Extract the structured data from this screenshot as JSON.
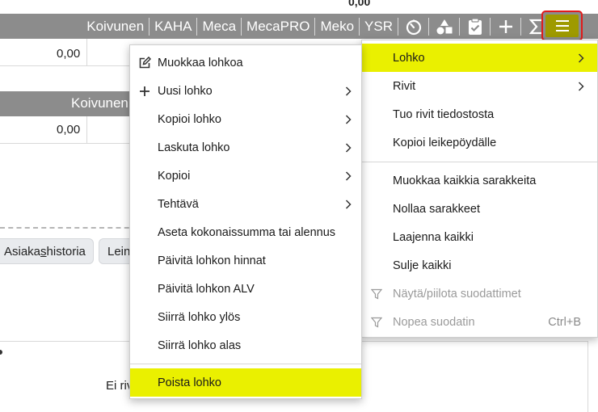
{
  "toolbar": {
    "tabs": [
      "Koivunen",
      "KAHA",
      "Meca",
      "MecaPRO",
      "Meko",
      "YSR"
    ],
    "tools": [
      "timer-icon",
      "shapes-icon",
      "clipboard-check-icon",
      "plus-icon",
      "sigma-icon"
    ],
    "menu_icon": "hamburger-menu-icon"
  },
  "background": {
    "top_total": "0,00",
    "row1_value": "0,00",
    "second_tab": "Koivunen",
    "row2_value": "0,00",
    "pill1_prefix": "Asiaka",
    "pill1_underlined": "s",
    "pill1_suffix": "historia",
    "pill2": "Lein",
    "empty_text": "Ei riv"
  },
  "main_menu": {
    "items": [
      {
        "label": "Lohko",
        "submenu": true,
        "highlighted": true
      },
      {
        "label": "Rivit",
        "submenu": true
      },
      {
        "label": "Tuo rivit tiedostosta"
      },
      {
        "label": "Kopioi leikepöydälle"
      },
      {
        "label": "Muokkaa kaikkia sarakkeita"
      },
      {
        "label": "Nollaa sarakkeet"
      },
      {
        "label": "Laajenna kaikki"
      },
      {
        "label": "Sulje kaikki"
      },
      {
        "label": "Näytä/piilota suodattimet",
        "icon": "filter-icon",
        "disabled": true
      },
      {
        "label": "Nopea suodatin",
        "icon": "filter-icon",
        "shortcut": "Ctrl+B",
        "disabled": true
      }
    ]
  },
  "sub_menu": {
    "items": [
      {
        "label": "Muokkaa lohkoa",
        "icon": "edit-icon"
      },
      {
        "label": "Uusi lohko",
        "icon": "plus-icon",
        "submenu": true
      },
      {
        "label": "Kopioi lohko",
        "submenu": true
      },
      {
        "label": "Laskuta lohko",
        "submenu": true
      },
      {
        "label": "Kopioi",
        "submenu": true
      },
      {
        "label": "Tehtävä",
        "submenu": true
      },
      {
        "label": "Aseta kokonaissumma tai alennus"
      },
      {
        "label": "Päivitä lohkon hinnat"
      },
      {
        "label": "Päivitä lohkon ALV"
      },
      {
        "label": "Siirrä lohko ylös"
      },
      {
        "label": "Siirrä lohko alas"
      },
      {
        "label": "Poista lohko",
        "highlighted": true
      }
    ]
  },
  "colors": {
    "toolbar_bg": "#8c8c8c",
    "highlight": "#eaf000",
    "menu_button_bg": "#9e9a00",
    "menu_button_border": "#e01b1b"
  }
}
